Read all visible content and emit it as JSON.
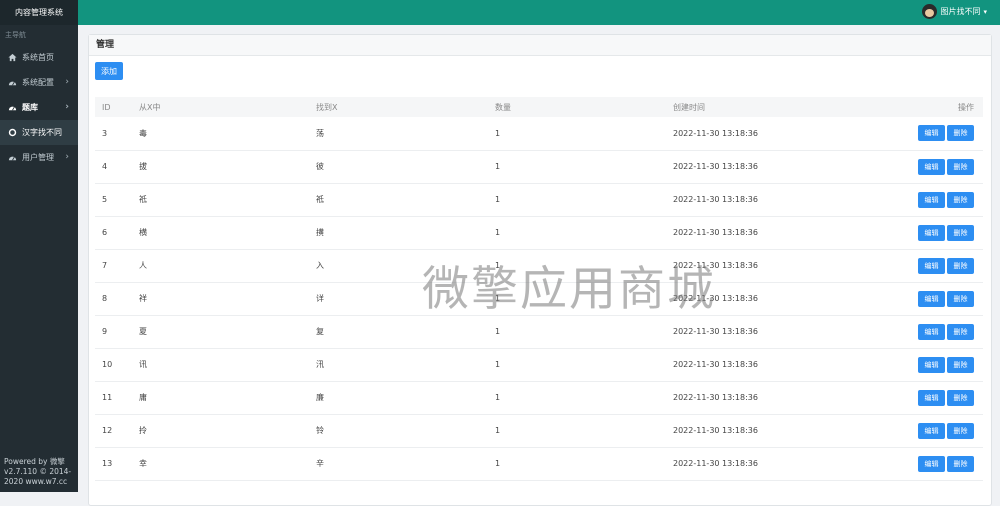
{
  "sidebar": {
    "brand": "内容管理系统",
    "section": "主导航",
    "items": [
      {
        "label": "系统首页",
        "icon": "home-icon"
      },
      {
        "label": "系统配置",
        "icon": "dashboard-icon",
        "chevron": "›"
      },
      {
        "label": "题库",
        "icon": "dashboard-icon",
        "chevron": "›"
      },
      {
        "label": "汉字找不同",
        "icon": "circle-icon"
      },
      {
        "label": "用户管理",
        "icon": "dashboard-icon",
        "chevron": "›"
      }
    ],
    "footer": {
      "line1": "Powered by 微擎",
      "line2": "v2.7.110 © 2014-",
      "line3": "2020 www.w7.cc"
    }
  },
  "header": {
    "user_name": "图片找不同",
    "caret": "▾"
  },
  "panel": {
    "title": "管理",
    "add_label": "添加"
  },
  "table": {
    "headers": {
      "id": "ID",
      "from": "从X中",
      "find": "找到X",
      "count": "数量",
      "created": "创建时间",
      "ops": "操作"
    },
    "edit_label": "编辑",
    "delete_label": "删除",
    "rows": [
      {
        "id": "3",
        "from": "毒",
        "find": "荡",
        "count": "1",
        "created": "2022-11-30 13:18:36"
      },
      {
        "id": "4",
        "from": "拔",
        "find": "彼",
        "count": "1",
        "created": "2022-11-30 13:18:36"
      },
      {
        "id": "5",
        "from": "祗",
        "find": "祗",
        "count": "1",
        "created": "2022-11-30 13:18:36"
      },
      {
        "id": "6",
        "from": "横",
        "find": "撗",
        "count": "1",
        "created": "2022-11-30 13:18:36"
      },
      {
        "id": "7",
        "from": "人",
        "find": "入",
        "count": "1",
        "created": "2022-11-30 13:18:36"
      },
      {
        "id": "8",
        "from": "祥",
        "find": "详",
        "count": "1",
        "created": "2022-11-30 13:18:36"
      },
      {
        "id": "9",
        "from": "夏",
        "find": "复",
        "count": "1",
        "created": "2022-11-30 13:18:36"
      },
      {
        "id": "10",
        "from": "讯",
        "find": "汛",
        "count": "1",
        "created": "2022-11-30 13:18:36"
      },
      {
        "id": "11",
        "from": "庸",
        "find": "廉",
        "count": "1",
        "created": "2022-11-30 13:18:36"
      },
      {
        "id": "12",
        "from": "拎",
        "find": "铃",
        "count": "1",
        "created": "2022-11-30 13:18:36"
      },
      {
        "id": "13",
        "from": "幸",
        "find": "辛",
        "count": "1",
        "created": "2022-11-30 13:18:36"
      }
    ]
  },
  "watermark": "微擎应用商城",
  "colors": {
    "header": "#12947f",
    "sidebar": "#232d33",
    "primary": "#2d8ef2"
  }
}
